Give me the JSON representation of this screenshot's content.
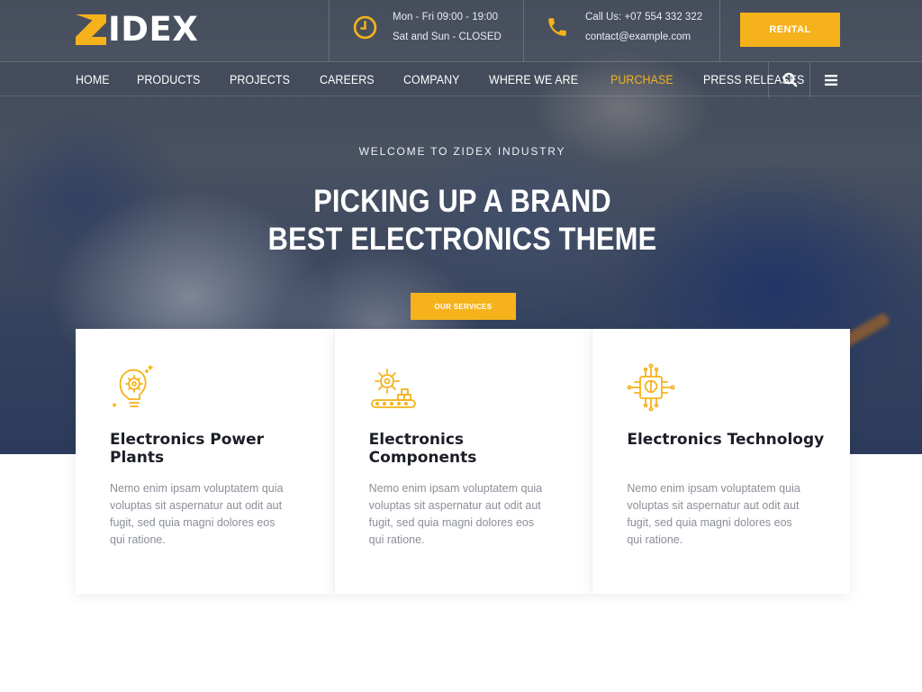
{
  "brand": {
    "name": "IDEX",
    "accent_color": "#f5b21b"
  },
  "topbar": {
    "hours": {
      "icon": "clock-icon",
      "line1": "Mon - Fri 09:00 - 19:00",
      "line2": "Sat and Sun - CLOSED"
    },
    "contact": {
      "icon": "phone-icon",
      "line1": "Call Us: +07 554 332 322",
      "line2": "contact@example.com"
    },
    "rental_label": "RENTAL"
  },
  "nav": {
    "items": [
      {
        "label": "HOME"
      },
      {
        "label": "PRODUCTS"
      },
      {
        "label": "PROJECTS"
      },
      {
        "label": "CAREERS"
      },
      {
        "label": "COMPANY"
      },
      {
        "label": "WHERE WE ARE"
      },
      {
        "label": "PURCHASE",
        "active": true
      },
      {
        "label": "PRESS RELEASES"
      }
    ],
    "search_icon": "search-icon",
    "menu_icon": "hamburger-menu-icon"
  },
  "hero": {
    "kicker": "WELCOME TO ZIDEX INDUSTRY",
    "headline_line1": "PICKING UP A BRAND",
    "headline_line2": "BEST ELECTRONICS THEME",
    "button_label": "OUR SERVICES"
  },
  "cards": [
    {
      "icon": "lightbulb-gear-icon",
      "title": "Electronics Power Plants",
      "text": "Nemo enim ipsam voluptatem quia voluptas sit aspernatur aut odit aut fugit, sed quia magni dolores eos qui ratione."
    },
    {
      "icon": "gear-conveyor-icon",
      "title": "Electronics Components",
      "text": "Nemo enim ipsam voluptatem quia voluptas sit aspernatur aut odit aut fugit, sed quia magni dolores eos qui ratione."
    },
    {
      "icon": "brain-chip-icon",
      "title": "Electronics Technology",
      "text": "Nemo enim ipsam voluptatem quia voluptas sit aspernatur aut odit aut fugit, sed quia magni dolores eos qui ratione."
    }
  ]
}
